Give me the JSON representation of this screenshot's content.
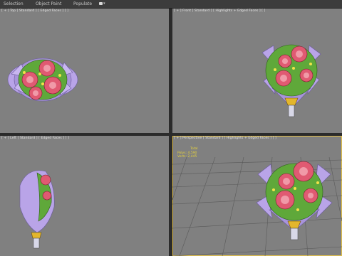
{
  "menubar": {
    "tabs": [
      "Selection",
      "Object Paint",
      "Populate"
    ],
    "extra_icon": "object-paint-options-icon"
  },
  "viewports": {
    "top": {
      "label": "[ + ] Top [ Standard ] [ Edged Faces ] [ ]"
    },
    "front": {
      "label": "[ + ] Front [ Standard ] [ Highlights + Edged Faces ] [ ]"
    },
    "left": {
      "label": "[ + ] Left [ Standard ] [ Edged Faces ] [ ]"
    },
    "perspective": {
      "label": "[ + ] Perspective [ Standard ] [ Highlights + Edged Faces ] [ ]",
      "stats": {
        "heading": "Total",
        "polys_label": "Polys:",
        "polys_value": "4,590",
        "verts_label": "Verts:",
        "verts_value": "2,445"
      }
    }
  },
  "colors": {
    "viewport_bg": "#808080",
    "active_border": "#e2c04a",
    "rose": "#e05a72",
    "leaf": "#5fa83a",
    "wrap": "#b9a4e8",
    "ribbon": "#e3b62c",
    "stats": "#e7d33b"
  }
}
